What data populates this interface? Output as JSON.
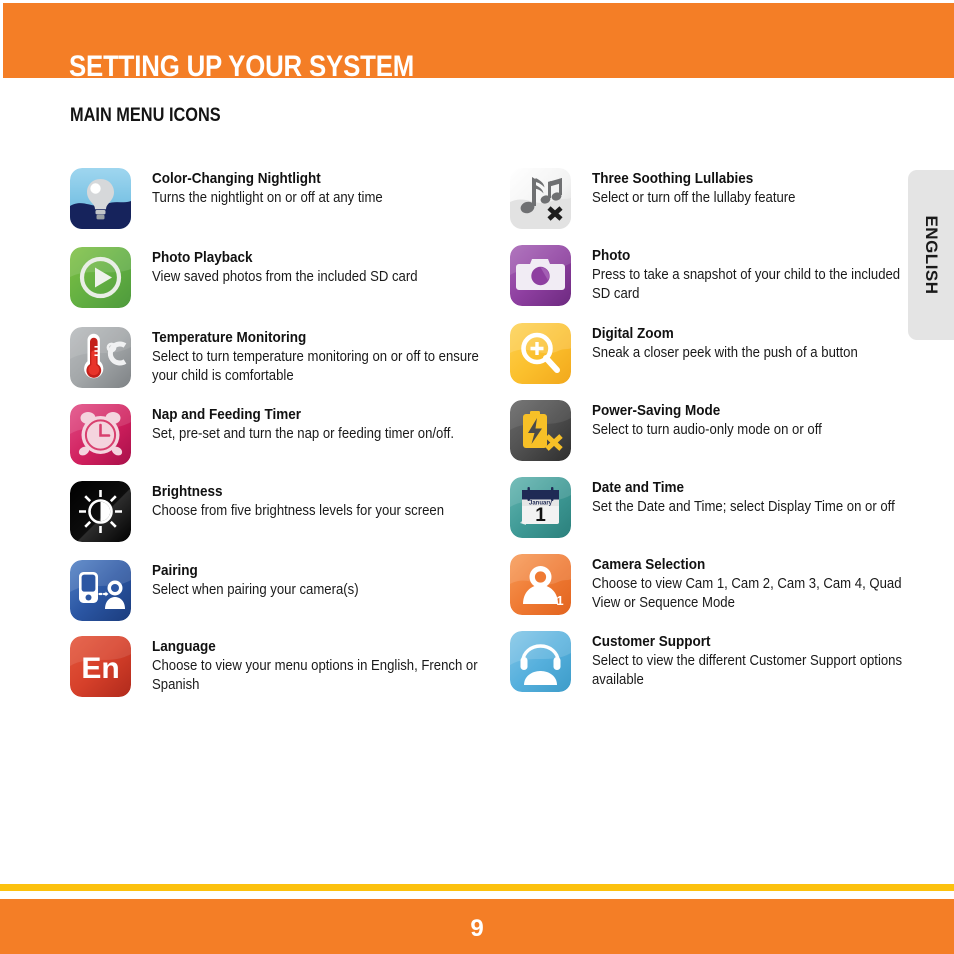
{
  "header": {
    "title": "SETTING UP YOUR SYSTEM"
  },
  "section": {
    "title": "MAIN MENU ICONS"
  },
  "side_tab": {
    "label": "ENGLISH"
  },
  "footer": {
    "page_number": "9"
  },
  "colors": {
    "header_orange": "#f47e26",
    "footer_orange": "#f47e26",
    "footer_rule_yellow": "#fcc10e",
    "side_tab_gray": "#e4e4e4",
    "text_black": "#111111"
  },
  "columns": {
    "left": [
      {
        "icon": "nightlight-icon",
        "title": "Color-Changing Nightlight",
        "desc": "Turns the nightlight on or off at any time"
      },
      {
        "icon": "photo-playback-icon",
        "title": "Photo Playback",
        "desc": "View saved photos from the included SD card"
      },
      {
        "icon": "temperature-icon",
        "title": "Temperature Monitoring",
        "desc": "Select to turn temperature monitoring on or off to ensure your child is comfortable"
      },
      {
        "icon": "nap-feeding-timer-icon",
        "title": "Nap and Feeding Timer",
        "desc": "Set, pre-set and turn the nap or feeding timer on/off."
      },
      {
        "icon": "brightness-icon",
        "title": "Brightness",
        "desc": "Choose from five brightness levels for your screen"
      },
      {
        "icon": "pairing-icon",
        "title": "Pairing",
        "desc": "Select when pairing your camera(s)"
      },
      {
        "icon": "language-icon",
        "title": "Language",
        "desc": "Choose to view your menu options in English, French or Spanish",
        "icon_label": "En"
      }
    ],
    "right": [
      {
        "icon": "lullabies-icon",
        "title": "Three Soothing Lullabies",
        "desc": "Select or turn off the lullaby feature"
      },
      {
        "icon": "photo-icon",
        "title": "Photo",
        "desc": "Press to take a snapshot of your child to the included SD card"
      },
      {
        "icon": "digital-zoom-icon",
        "title": "Digital Zoom",
        "desc": "Sneak a closer peek with the push of a button"
      },
      {
        "icon": "power-saving-icon",
        "title": "Power-Saving Mode",
        "desc": "Select to turn audio-only mode on or off"
      },
      {
        "icon": "date-time-icon",
        "title": "Date and Time",
        "desc": "Set the Date and Time; select Display Time on or off",
        "icon_month": "January",
        "icon_day": "1"
      },
      {
        "icon": "camera-selection-icon",
        "title": "Camera Selection",
        "desc": "Choose to view Cam 1, Cam 2, Cam 3, Cam 4, Quad View or Sequence Mode",
        "icon_label": "1"
      },
      {
        "icon": "customer-support-icon",
        "title": "Customer Support",
        "desc": "Select to view the different Customer Support options available"
      }
    ]
  }
}
